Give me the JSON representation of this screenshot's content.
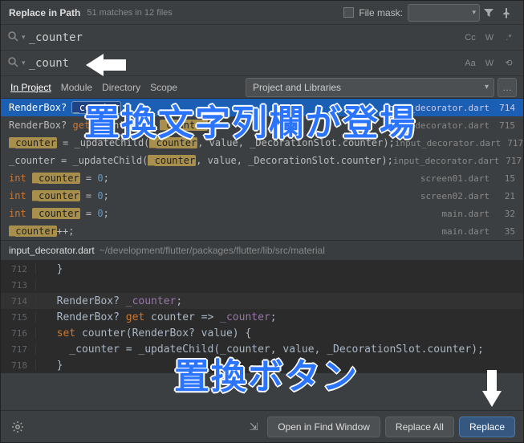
{
  "titlebar": {
    "title": "Replace in Path",
    "subtitle": "51 matches in 12 files",
    "filemask_label": "File mask:"
  },
  "search": {
    "value": "_counter",
    "options": {
      "cc": "Cc",
      "w": "W",
      "regex": ".*"
    }
  },
  "replace": {
    "value": "_count",
    "options": {
      "aa": "Aa",
      "w": "W",
      "preserve": "⟲"
    }
  },
  "scope": {
    "tabs": [
      "In Project",
      "Module",
      "Directory",
      "Scope"
    ],
    "combo": "Project and Libraries",
    "ellipsis": "…"
  },
  "results": [
    {
      "selected": true,
      "file": "input_decorator.dart",
      "lineno": "714",
      "segs": [
        {
          "t": "RenderBox? ",
          "c": ""
        },
        {
          "t": "_counter",
          "c": "hl"
        },
        {
          "t": ";",
          "c": ""
        }
      ]
    },
    {
      "file": "input_decorator.dart",
      "lineno": "715",
      "segs": [
        {
          "t": "RenderBox? ",
          "c": ""
        },
        {
          "t": "get",
          "c": "c-kw"
        },
        {
          "t": " counter => ",
          "c": ""
        },
        {
          "t": "_counter",
          "c": "hl"
        },
        {
          "t": ";",
          "c": ""
        }
      ]
    },
    {
      "file": "input_decorator.dart",
      "lineno": "717",
      "segs": [
        {
          "t": "_counter",
          "c": "hl"
        },
        {
          "t": " = _updateChild(",
          "c": ""
        },
        {
          "t": "_counter",
          "c": "hl"
        },
        {
          "t": ", value, _DecorationSlot.counter);",
          "c": ""
        }
      ]
    },
    {
      "file": "input_decorator.dart",
      "lineno": "717",
      "segs": [
        {
          "t": "_counter = _updateChild(",
          "c": ""
        },
        {
          "t": "_counter",
          "c": "hl"
        },
        {
          "t": ", value, _DecorationSlot.counter);",
          "c": ""
        }
      ]
    },
    {
      "file": "screen01.dart",
      "lineno": "15",
      "segs": [
        {
          "t": "int ",
          "c": "c-kw"
        },
        {
          "t": "_counter",
          "c": "hl"
        },
        {
          "t": " = ",
          "c": ""
        },
        {
          "t": "0",
          "c": "c-num"
        },
        {
          "t": ";",
          "c": ""
        }
      ]
    },
    {
      "file": "screen02.dart",
      "lineno": "21",
      "segs": [
        {
          "t": "int ",
          "c": "c-kw"
        },
        {
          "t": "_counter",
          "c": "hl"
        },
        {
          "t": " = ",
          "c": ""
        },
        {
          "t": "0",
          "c": "c-num"
        },
        {
          "t": ";",
          "c": ""
        }
      ]
    },
    {
      "file": "main.dart",
      "lineno": "32",
      "segs": [
        {
          "t": "int ",
          "c": "c-kw"
        },
        {
          "t": "_counter",
          "c": "hl"
        },
        {
          "t": " = ",
          "c": ""
        },
        {
          "t": "0",
          "c": "c-num"
        },
        {
          "t": ";",
          "c": ""
        }
      ]
    },
    {
      "file": "main.dart",
      "lineno": "35",
      "segs": [
        {
          "t": "_counter",
          "c": "hl"
        },
        {
          "t": "++;",
          "c": ""
        }
      ]
    }
  ],
  "preview": {
    "file": "input_decorator.dart",
    "path": "~/development/flutter/packages/flutter/lib/src/material",
    "lines": [
      {
        "n": "712",
        "segs": [
          {
            "t": "  }",
            "c": ""
          }
        ]
      },
      {
        "n": "713",
        "segs": [
          {
            "t": "",
            "c": ""
          }
        ]
      },
      {
        "n": "714",
        "sel": true,
        "segs": [
          {
            "t": "  RenderBox? ",
            "c": "c-type"
          },
          {
            "t": "_counter",
            "c": "c-field"
          },
          {
            "t": ";",
            "c": ""
          }
        ]
      },
      {
        "n": "715",
        "segs": [
          {
            "t": "  RenderBox? ",
            "c": "c-type"
          },
          {
            "t": "get",
            "c": "c-kw"
          },
          {
            "t": " counter => ",
            "c": ""
          },
          {
            "t": "_counter",
            "c": "c-field"
          },
          {
            "t": ";",
            "c": ""
          }
        ]
      },
      {
        "n": "716",
        "segs": [
          {
            "t": "  ",
            "c": ""
          },
          {
            "t": "set",
            "c": "c-kw"
          },
          {
            "t": " counter(RenderBox? value) {",
            "c": ""
          }
        ]
      },
      {
        "n": "717",
        "segs": [
          {
            "t": "    _counter = _updateChild(_counter, value, _DecorationSlot.counter);",
            "c": ""
          }
        ]
      },
      {
        "n": "718",
        "segs": [
          {
            "t": "  }",
            "c": ""
          }
        ]
      }
    ]
  },
  "footer": {
    "open": "Open in Find Window",
    "replace_all": "Replace All",
    "replace": "Replace"
  },
  "annotations": {
    "replace_field": "置換文字列欄が登場",
    "replace_button": "置換ボタン"
  }
}
